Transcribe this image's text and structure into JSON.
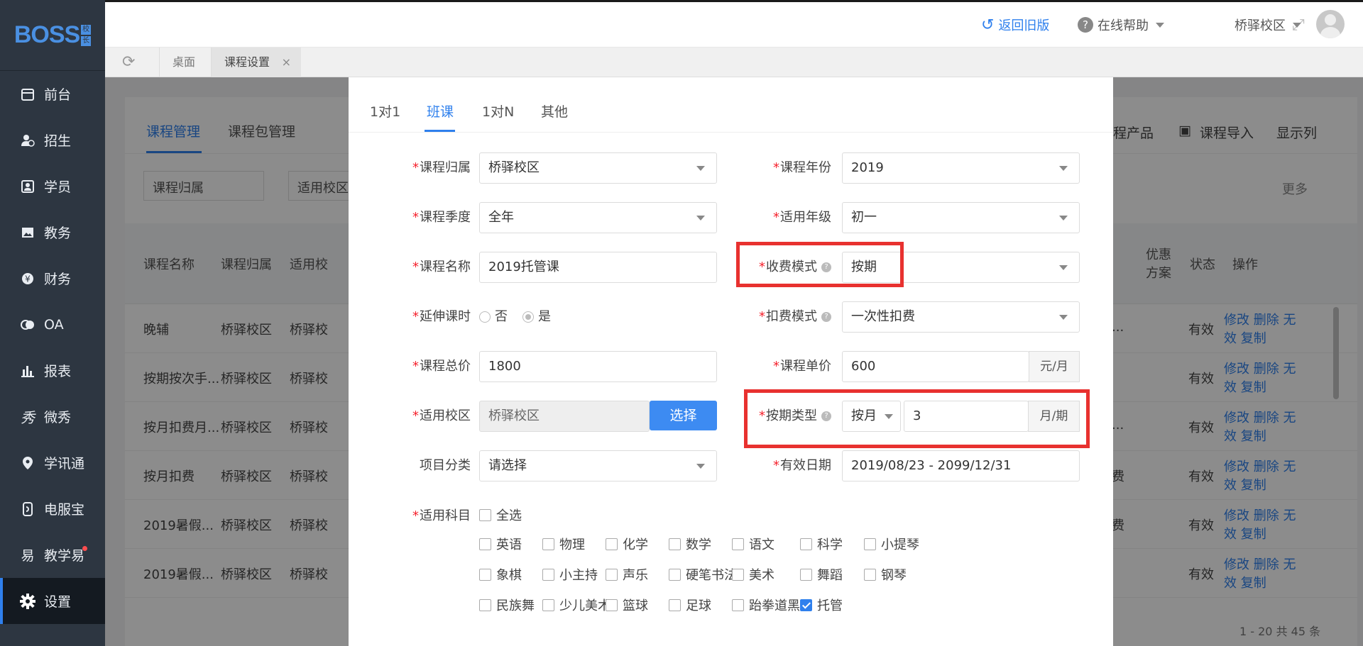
{
  "brand": {
    "logo": "BOSS",
    "logo_sub": [
      "校",
      "长"
    ]
  },
  "sidebar": {
    "items": [
      {
        "label": "前台",
        "icon": "calendar-icon"
      },
      {
        "label": "招生",
        "icon": "user-add-icon"
      },
      {
        "label": "学员",
        "icon": "id-card-icon"
      },
      {
        "label": "教务",
        "icon": "picture-icon"
      },
      {
        "label": "财务",
        "icon": "yen-icon"
      },
      {
        "label": "OA",
        "icon": "chat-icon"
      },
      {
        "label": "报表",
        "icon": "bar-chart-icon"
      },
      {
        "label": "微秀",
        "icon": "xiu-icon"
      },
      {
        "label": "学讯通",
        "icon": "location-icon"
      },
      {
        "label": "电服宝",
        "icon": "phone-icon"
      },
      {
        "label": "教学易",
        "icon": "teach-icon"
      },
      {
        "label": "设置",
        "icon": "gear-icon"
      }
    ]
  },
  "header": {
    "back": "返回旧版",
    "help": "在线帮助",
    "campus": "桥驿校区"
  },
  "page_tabs": {
    "desktop": "桌面",
    "course_settings": "课程设置",
    "close": "×"
  },
  "background": {
    "tabs": [
      "课程管理",
      "课程包管理"
    ],
    "filters": [
      "课程归属",
      "适用校区"
    ],
    "right_actions": [
      "程产品",
      "课程导入",
      "显示列"
    ],
    "more": "更多",
    "headers": [
      "课程名称",
      "课程归属",
      "适用校",
      "优惠",
      "方案",
      "状态",
      "操作"
    ],
    "rows": [
      {
        "name": "晚辅",
        "owner": "桥驿校区",
        "campus": "桥驿校",
        "discount": "...",
        "status": "有效"
      },
      {
        "name": "按期按次手...",
        "owner": "桥驿校区",
        "campus": "桥驿校",
        "discount": "",
        "status": "有效"
      },
      {
        "name": "按月扣费月...",
        "owner": "桥驿校区",
        "campus": "桥驿校",
        "discount": "...",
        "status": "有效"
      },
      {
        "name": "按月扣费",
        "owner": "桥驿校区",
        "campus": "桥驿校",
        "discount": "费",
        "status": "有效"
      },
      {
        "name": "2019暑假...",
        "owner": "桥驿校区",
        "campus": "桥驿校",
        "discount": "费",
        "status": "有效"
      },
      {
        "name": "2019暑假...",
        "owner": "桥驿校区",
        "campus": "桥驿校",
        "discount": "",
        "status": "有效"
      }
    ],
    "ops": "修改 删除 无效 复制",
    "pager": "1 - 20  共 45 条"
  },
  "modal": {
    "tabs": [
      "1对1",
      "班课",
      "1对N",
      "其他"
    ],
    "fields": {
      "owner_label": "课程归属",
      "owner": "桥驿校区",
      "year_label": "课程年份",
      "year": "2019",
      "season_label": "课程季度",
      "season": "全年",
      "grade_label": "适用年级",
      "grade": "初一",
      "name_label": "课程名称",
      "name": "2019托管课",
      "charge_mode_label": "收费模式",
      "charge_mode": "按期",
      "extend_label": "延伸课时",
      "extend_no": "否",
      "extend_yes": "是",
      "deduct_mode_label": "扣费模式",
      "deduct_mode": "一次性扣费",
      "total_label": "课程总价",
      "total": "1800",
      "unit_label": "课程单价",
      "unit": "600",
      "unit_addon": "元/月",
      "campus_label": "适用校区",
      "campus": "桥驿校区",
      "choose": "选择",
      "period_label": "按期类型",
      "period_type": "按月",
      "period_value": "3",
      "period_addon": "月/期",
      "category_label": "项目分类",
      "category": "请选择",
      "valid_label": "有效日期",
      "valid": "2019/08/23 - 2099/12/31",
      "subjects_label": "适用科目",
      "select_all": "全选"
    },
    "subjects": [
      [
        "英语",
        "物理",
        "化学",
        "数学",
        "语文",
        "科学",
        "小提琴"
      ],
      [
        "象棋",
        "小主持",
        "声乐",
        "硬笔书法",
        "美术",
        "舞蹈",
        "钢琴"
      ],
      [
        "民族舞",
        "少儿美术",
        "篮球",
        "足球",
        "跆拳道黑",
        "托管"
      ]
    ],
    "checked_subject": "托管"
  }
}
